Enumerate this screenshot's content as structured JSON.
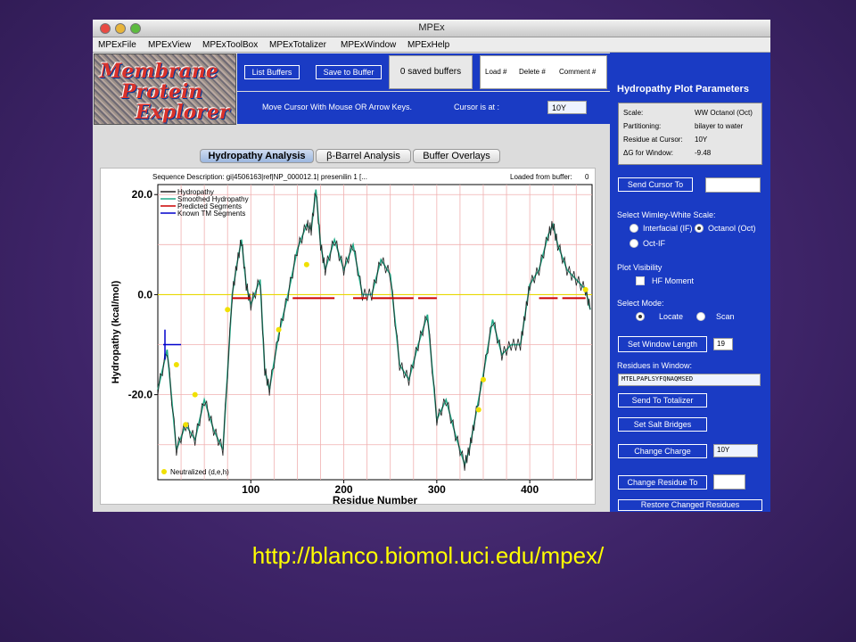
{
  "window": {
    "title": "MPEx",
    "menu": [
      "MPExFile",
      "MPExView",
      "MPExToolBox",
      "MPExTotalizer",
      "MPExWindow",
      "MPExHelp"
    ]
  },
  "logo": {
    "words": [
      "Membrane",
      "Protein",
      "Explorer"
    ]
  },
  "buffers": {
    "list_label": "List Buffers",
    "save_label": "Save to Buffer",
    "saved_count": "0 saved buffers",
    "load_label": "Load #",
    "delete_label": "Delete #",
    "comment_label": "Comment #"
  },
  "cursor_row": {
    "instruction": "Move Cursor With Mouse OR Arrow Keys.",
    "cursor_label": "Cursor is at :",
    "cursor_value": "10Y"
  },
  "tabs": [
    "Hydropathy Analysis",
    "β-Barrel Analysis",
    "Buffer Overlays"
  ],
  "plot_header": {
    "sequence": "Sequence Description: gi|4506163|ref|NP_000012.1| presenilin 1 [...",
    "loaded": "Loaded from buffer:",
    "loaded_value": "0"
  },
  "chart_data": {
    "type": "line",
    "xlabel": "Residue Number",
    "ylabel": "Hydropathy (kcal/mol)",
    "xlim": [
      0,
      467
    ],
    "ylim": [
      -37,
      22
    ],
    "xticks": [
      "100",
      "200",
      "300",
      "400"
    ],
    "xtick_values": [
      100,
      200,
      300,
      400
    ],
    "yticks": [
      "20.0",
      "0.0",
      "-20.0"
    ],
    "ytick_values": [
      20,
      0,
      -20
    ],
    "legend": [
      "Hydropathy",
      "Smoothed Hydropathy",
      "Predicted Segments",
      "Known TM Segments"
    ],
    "legend_position": "top-left",
    "neutralized_label": "Neutralized (d,e,h)",
    "colors": {
      "hydropathy": "#222222",
      "smoothed": "#22aa88",
      "predicted": "#cc0000",
      "known": "#0000cc",
      "zero_line": "#e8d800",
      "grid": "#f0b0b0",
      "neutralized": "#f0e000"
    },
    "x": [
      0,
      10,
      20,
      30,
      40,
      50,
      60,
      70,
      80,
      85,
      90,
      95,
      100,
      110,
      115,
      120,
      130,
      140,
      150,
      160,
      165,
      170,
      175,
      180,
      190,
      200,
      210,
      220,
      230,
      240,
      250,
      260,
      270,
      280,
      290,
      300,
      310,
      320,
      330,
      335,
      340,
      350,
      360,
      370,
      380,
      390,
      395,
      400,
      410,
      420,
      425,
      430,
      440,
      450,
      460,
      465
    ],
    "y": [
      -19,
      -11,
      -31,
      -26,
      -29,
      -21,
      -27,
      -31,
      0,
      6,
      11,
      2,
      -2,
      3,
      -15,
      -19,
      -8,
      0,
      9,
      14,
      13,
      21,
      10,
      5,
      11,
      5,
      10,
      0,
      0,
      7,
      4,
      -14,
      -17,
      -10,
      -4,
      -25,
      -21,
      -28,
      -34,
      -31,
      -26,
      -16,
      -5,
      -12,
      -10,
      -10,
      -4,
      2,
      5,
      12,
      14,
      10,
      5,
      3,
      1,
      -3
    ],
    "predicted_segments": [
      [
        80,
        100
      ],
      [
        145,
        190
      ],
      [
        210,
        225
      ],
      [
        230,
        275
      ],
      [
        280,
        300
      ],
      [
        410,
        430
      ],
      [
        435,
        460
      ]
    ],
    "known_segments": [
      [
        0,
        25
      ]
    ],
    "neutralized_points": [
      [
        20,
        -14
      ],
      [
        30,
        -26
      ],
      [
        40,
        -20
      ],
      [
        75,
        -3
      ],
      [
        130,
        -7
      ],
      [
        160,
        6
      ],
      [
        345,
        -23
      ],
      [
        350,
        -17
      ],
      [
        460,
        1
      ]
    ]
  },
  "params": {
    "title": "Hydropathy Plot Parameters",
    "rows": [
      {
        "key": "Scale:",
        "value": "WW Octanol (Oct)"
      },
      {
        "key": "Partitioning:",
        "value": "bilayer to water"
      },
      {
        "key": "Residue at Cursor:",
        "value": "10Y"
      },
      {
        "key": "ΔG for Window:",
        "value": "-9.48"
      }
    ]
  },
  "controls": {
    "send_cursor_label": "Send Cursor To",
    "scale_heading": "Select Wimley-White Scale:",
    "scale_options": [
      "Interfacial (IF)",
      "Octanol (Oct)",
      "Oct-IF"
    ],
    "visibility_heading": "Plot Visibility",
    "hf_moment_label": "HF Moment",
    "mode_heading": "Select Mode:",
    "mode_options": [
      "Locate",
      "Scan"
    ],
    "window_length_label": "Set Window Length",
    "window_length_value": "19",
    "residues_heading": "Residues in Window:",
    "residues_value": "MTELPAPLSYFQNAQMSED",
    "send_totalizer_label": "Send To Totalizer",
    "salt_bridges_label": "Set Salt Bridges",
    "change_charge_label": "Change Charge",
    "change_charge_value": "10Y",
    "change_residue_label": "Change Residue To",
    "restore_label": "Restore Changed Residues"
  },
  "footer": {
    "url": "http://blanco.biomol.uci.edu/mpex/"
  }
}
